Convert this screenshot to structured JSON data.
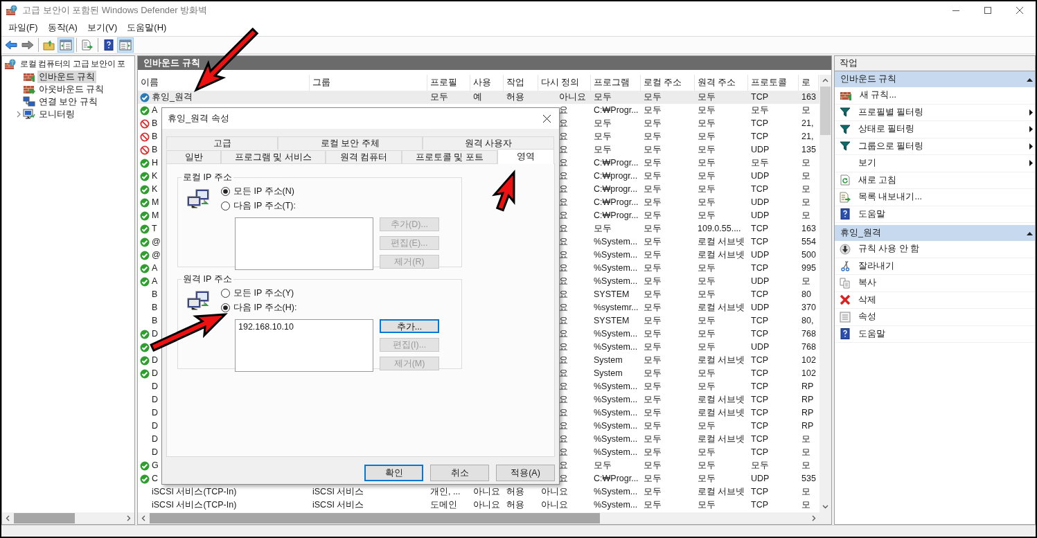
{
  "window": {
    "title": "고급 보안이 포함된 Windows Defender 방화벽"
  },
  "menu": [
    "파일(F)",
    "동작(A)",
    "보기(V)",
    "도움말(H)"
  ],
  "toolbar": [
    [
      {
        "kind": "back",
        "pressed": false
      },
      {
        "kind": "forward",
        "pressed": false
      }
    ],
    [
      {
        "kind": "up",
        "pressed": false
      },
      {
        "kind": "tree",
        "pressed": true
      }
    ],
    [
      {
        "kind": "export",
        "pressed": false
      }
    ],
    [
      {
        "kind": "help",
        "pressed": false
      },
      {
        "kind": "actions",
        "pressed": true
      }
    ]
  ],
  "tree": [
    {
      "label": "로컬 컴퓨터의 고급 보안이 포",
      "kind": "root",
      "selected": false,
      "children": [
        {
          "label": "인바운드 규칙",
          "kind": "inbound",
          "selected": true
        },
        {
          "label": "아웃바운드 규칙",
          "kind": "outbound",
          "selected": false
        },
        {
          "label": "연결 보안 규칙",
          "kind": "connection",
          "selected": false
        },
        {
          "label": "모니터링",
          "kind": "monitor",
          "selected": false,
          "expanded": false
        }
      ]
    }
  ],
  "center": {
    "title": "인바운드 규칙"
  },
  "table": {
    "columns": [
      "이름",
      "그룹",
      "프로필",
      "사용",
      "작업",
      "다시 정의",
      "프로그램",
      "로컬 주소",
      "원격 주소",
      "프로토콜",
      "로"
    ],
    "rows": [
      {
        "kind": "custom",
        "selected": true,
        "name": "휴잉_원격",
        "profile": "모두",
        "enabled": "예",
        "action": "허용",
        "override": "아니요",
        "program": "모두",
        "local_address": "모두",
        "remote_address": "모두",
        "protocol": "TCP",
        "local_port": "163"
      },
      {
        "kind": "allow",
        "selected": false,
        "name": "A",
        "override": "요",
        "program": "C:₩Progr...",
        "local_address": "모두",
        "remote_address": "모두",
        "protocol": "모두",
        "local_port": "모"
      },
      {
        "kind": "block",
        "selected": false,
        "name": "B",
        "override": "요",
        "program": "모두",
        "local_address": "모두",
        "remote_address": "모두",
        "protocol": "TCP",
        "local_port": "21,"
      },
      {
        "kind": "block",
        "selected": false,
        "name": "B",
        "override": "요",
        "program": "모두",
        "local_address": "모두",
        "remote_address": "모두",
        "protocol": "TCP",
        "local_port": "21,"
      },
      {
        "kind": "block",
        "selected": false,
        "name": "B",
        "override": "요",
        "program": "모두",
        "local_address": "모두",
        "remote_address": "모두",
        "protocol": "UDP",
        "local_port": "135"
      },
      {
        "kind": "allow",
        "selected": false,
        "name": "H",
        "override": "요",
        "program": "C:₩Progr...",
        "local_address": "모두",
        "remote_address": "모두",
        "protocol": "모두",
        "local_port": "모"
      },
      {
        "kind": "allow",
        "selected": false,
        "name": "K",
        "override": "요",
        "program": "C:₩progr...",
        "local_address": "모두",
        "remote_address": "모두",
        "protocol": "UDP",
        "local_port": "모"
      },
      {
        "kind": "allow",
        "selected": false,
        "name": "K",
        "override": "요",
        "program": "C:₩progr...",
        "local_address": "모두",
        "remote_address": "모두",
        "protocol": "TCP",
        "local_port": "모"
      },
      {
        "kind": "allow",
        "selected": false,
        "name": "M",
        "override": "요",
        "program": "C:₩Progr...",
        "local_address": "모두",
        "remote_address": "모두",
        "protocol": "UDP",
        "local_port": "모"
      },
      {
        "kind": "allow",
        "selected": false,
        "name": "M",
        "override": "요",
        "program": "C:₩Progr...",
        "local_address": "모두",
        "remote_address": "모두",
        "protocol": "UDP",
        "local_port": "모"
      },
      {
        "kind": "allow",
        "selected": false,
        "name": "T",
        "override": "요",
        "program": "모두",
        "local_address": "모두",
        "remote_address": "109.0.55....",
        "protocol": "TCP",
        "local_port": "163"
      },
      {
        "kind": "allow",
        "selected": false,
        "name": "@",
        "override": "요",
        "program": "%System...",
        "local_address": "모두",
        "remote_address": "로컬 서브넷",
        "protocol": "TCP",
        "local_port": "554"
      },
      {
        "kind": "allow",
        "selected": false,
        "name": "@",
        "override": "요",
        "program": "%System...",
        "local_address": "모두",
        "remote_address": "로컬 서브넷",
        "protocol": "UDP",
        "local_port": "500"
      },
      {
        "kind": "allow",
        "selected": false,
        "name": "A",
        "override": "요",
        "program": "%System...",
        "local_address": "모두",
        "remote_address": "모두",
        "protocol": "TCP",
        "local_port": "995"
      },
      {
        "kind": "allow",
        "selected": false,
        "name": "A",
        "override": "요",
        "program": "%System...",
        "local_address": "모두",
        "remote_address": "모두",
        "protocol": "UDP",
        "local_port": "모"
      },
      {
        "kind": "plain",
        "selected": false,
        "name": "B",
        "override": "요",
        "program": "SYSTEM",
        "local_address": "모두",
        "remote_address": "모두",
        "protocol": "TCP",
        "local_port": "80"
      },
      {
        "kind": "plain",
        "selected": false,
        "name": "B",
        "override": "요",
        "program": "%systemr...",
        "local_address": "모두",
        "remote_address": "로컬 서브넷",
        "protocol": "UDP",
        "local_port": "370"
      },
      {
        "kind": "plain",
        "selected": false,
        "name": "B",
        "override": "요",
        "program": "SYSTEM",
        "local_address": "모두",
        "remote_address": "모두",
        "protocol": "TCP",
        "local_port": "80,"
      },
      {
        "kind": "allow",
        "selected": false,
        "name": "D",
        "override": "요",
        "program": "%System...",
        "local_address": "모두",
        "remote_address": "모두",
        "protocol": "TCP",
        "local_port": "768"
      },
      {
        "kind": "allow",
        "selected": false,
        "override": "요",
        "program": "%System...",
        "local_address": "모두",
        "remote_address": "모두",
        "protocol": "UDP",
        "local_port": "768"
      },
      {
        "kind": "allow",
        "selected": false,
        "name": "D",
        "override": "요",
        "program": "System",
        "local_address": "모두",
        "remote_address": "로컬 서브넷",
        "protocol": "TCP",
        "local_port": "102"
      },
      {
        "kind": "allow",
        "selected": false,
        "name": "D",
        "override": "요",
        "program": "System",
        "local_address": "모두",
        "remote_address": "모두",
        "protocol": "TCP",
        "local_port": "102"
      },
      {
        "kind": "plain",
        "selected": false,
        "name": "D",
        "override": "요",
        "program": "%System...",
        "local_address": "모두",
        "remote_address": "모두",
        "protocol": "TCP",
        "local_port": "RP"
      },
      {
        "kind": "plain",
        "selected": false,
        "name": "D",
        "override": "요",
        "program": "%System...",
        "local_address": "모두",
        "remote_address": "로컬 서브넷",
        "protocol": "TCP",
        "local_port": "RP"
      },
      {
        "kind": "plain",
        "selected": false,
        "name": "D",
        "override": "요",
        "program": "%System...",
        "local_address": "모두",
        "remote_address": "로컬 서브넷",
        "protocol": "TCP",
        "local_port": "RP"
      },
      {
        "kind": "plain",
        "selected": false,
        "name": "D",
        "override": "요",
        "program": "%System...",
        "local_address": "모두",
        "remote_address": "모두",
        "protocol": "TCP",
        "local_port": "RP"
      },
      {
        "kind": "plain",
        "selected": false,
        "name": "D",
        "override": "요",
        "program": "%System...",
        "local_address": "모두",
        "remote_address": "로컬 서브넷",
        "protocol": "TCP",
        "local_port": "모"
      },
      {
        "kind": "plain",
        "selected": false,
        "name": "D",
        "override": "요",
        "program": "%System...",
        "local_address": "모두",
        "remote_address": "모두",
        "protocol": "TCP",
        "local_port": "모"
      },
      {
        "kind": "allow",
        "selected": false,
        "name": "G",
        "override": "요",
        "program": "모두",
        "local_address": "모두",
        "remote_address": "모두",
        "protocol": "모두",
        "local_port": "모"
      },
      {
        "kind": "allow",
        "selected": false,
        "name": "C",
        "override": "요",
        "program": "C:₩Progr...",
        "local_address": "모두",
        "remote_address": "모두",
        "protocol": "UDP",
        "local_port": "535"
      },
      {
        "kind": "plain",
        "selected": false,
        "name": "iSCSI 서비스(TCP-In)",
        "group": "iSCSI 서비스",
        "profile": "개인, ...",
        "enabled": "아니요",
        "action": "허용",
        "override": "아니요",
        "program": "%System...",
        "local_address": "모두",
        "remote_address": "로컬 서브넷",
        "protocol": "TCP",
        "local_port": "모"
      },
      {
        "kind": "plain",
        "selected": false,
        "name": "iSCSI 서비스(TCP-In)",
        "group": "iSCSI 서비스",
        "profile": "도메인",
        "enabled": "아니요",
        "action": "허용",
        "override": "아니요",
        "program": "%System...",
        "local_address": "모두",
        "remote_address": "모두",
        "protocol": "TCP",
        "local_port": "모"
      }
    ]
  },
  "dialog": {
    "title": "휴잉_원격 속성",
    "tab_rows": [
      [
        {
          "label": "고급",
          "selected": false
        },
        {
          "label": "로컬 보안 주체",
          "selected": false
        },
        {
          "label": "원격 사용자",
          "selected": false
        }
      ],
      [
        {
          "label": "일반",
          "selected": false
        },
        {
          "label": "프로그램 및 서비스",
          "selected": false
        },
        {
          "label": "원격 컴퓨터",
          "selected": false
        },
        {
          "label": "프로토콜 및 포트",
          "selected": false
        },
        {
          "label": "영역",
          "selected": true
        }
      ]
    ],
    "groups": [
      {
        "title": "로컬 IP 주소",
        "options": [
          {
            "label": "모든 IP 주소(N)",
            "selected": true
          },
          {
            "label": "다음 IP 주소(T):",
            "selected": false
          }
        ],
        "buttons": [
          {
            "label": "추가(D)...",
            "disabled": true,
            "focused": false
          },
          {
            "label": "편집(E)...",
            "disabled": true,
            "focused": false
          },
          {
            "label": "제거(R)",
            "disabled": true,
            "focused": false
          }
        ]
      },
      {
        "title": "원격 IP 주소",
        "options": [
          {
            "label": "모든 IP 주소(Y)",
            "selected": false
          },
          {
            "label": "다음 IP 주소(H):",
            "selected": true
          }
        ],
        "addresses": [
          "192.168.10.10"
        ],
        "buttons": [
          {
            "label": "추가...",
            "disabled": false,
            "focused": true
          },
          {
            "label": "편집(I)...",
            "disabled": true,
            "focused": false
          },
          {
            "label": "제거(M)",
            "disabled": true,
            "focused": false
          }
        ]
      }
    ],
    "footer_buttons": [
      {
        "label": "확인",
        "default": true
      },
      {
        "label": "취소",
        "default": false
      },
      {
        "label": "적용(A)",
        "default": false
      }
    ]
  },
  "actions": {
    "title": "작업",
    "sections": [
      {
        "title": "인바운드 규칙",
        "expanded": true,
        "items": [
          {
            "label": "새 규칙...",
            "kind": "new-rule",
            "submenu": false
          },
          {
            "label": "프로필별 필터링",
            "kind": "filter",
            "submenu": true
          },
          {
            "label": "상태로 필터링",
            "kind": "filter",
            "submenu": true
          },
          {
            "label": "그룹으로 필터링",
            "kind": "filter",
            "submenu": true
          },
          {
            "label": "보기",
            "kind": "plain",
            "submenu": true
          },
          {
            "label": "새로 고침",
            "kind": "refresh",
            "submenu": false
          },
          {
            "label": "목록 내보내기...",
            "kind": "export",
            "submenu": false
          },
          {
            "label": "도움말",
            "kind": "help",
            "submenu": false
          }
        ]
      },
      {
        "title": "휴잉_원격",
        "expanded": true,
        "items": [
          {
            "label": "규칙 사용 안 함",
            "kind": "disable",
            "submenu": false
          },
          {
            "label": "잘라내기",
            "kind": "cut",
            "submenu": false
          },
          {
            "label": "복사",
            "kind": "copy",
            "submenu": false
          },
          {
            "label": "삭제",
            "kind": "delete",
            "submenu": false
          },
          {
            "label": "속성",
            "kind": "properties",
            "submenu": false
          },
          {
            "label": "도움말",
            "kind": "help",
            "submenu": false
          }
        ]
      }
    ]
  }
}
